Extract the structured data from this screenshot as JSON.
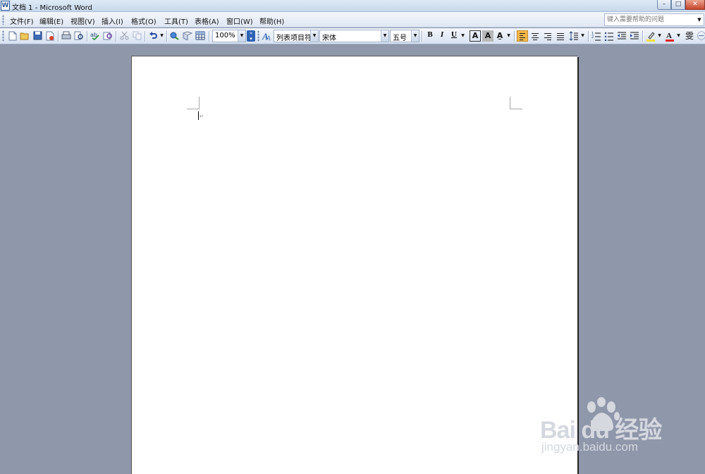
{
  "window": {
    "title": "文档 1 - Microsoft Word",
    "app_icon_letter": "W",
    "minimize": "–",
    "maximize": "□",
    "close": "✕"
  },
  "menu": {
    "items": [
      "文件(F)",
      "编辑(E)",
      "视图(V)",
      "插入(I)",
      "格式(O)",
      "工具(T)",
      "表格(A)",
      "窗口(W)",
      "帮助(H)"
    ],
    "help_placeholder": "键入需要帮助的问题"
  },
  "toolbar": {
    "zoom": "100%",
    "style": "列表项目符",
    "font": "宋体",
    "size": "五号",
    "bold": "B",
    "italic": "I",
    "underline": "U",
    "char_border": "A",
    "char_shading": "A",
    "char_scale": "A̱",
    "phonetic": "雯",
    "active_alignment": "align-left"
  },
  "document": {
    "paragraph_mark": "↵"
  },
  "watermark": {
    "logo": "Bai  du 经验",
    "url": "jingyan.baidu.com"
  },
  "colors": {
    "workspace": "#8f97aa",
    "highlight": "#f5e23a",
    "font_color": "#e0242a",
    "active_button": "#f5b849"
  }
}
